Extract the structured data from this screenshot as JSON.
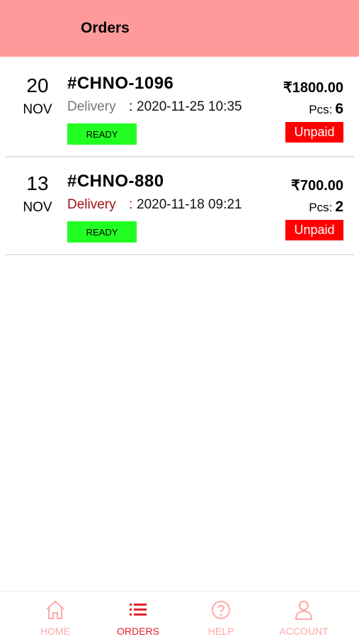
{
  "header": {
    "title": "Orders"
  },
  "orders": [
    {
      "day": "20",
      "month": "NOV",
      "order_no": "#CHNO-1096",
      "delivery_label": "Delivery",
      "colon": ":",
      "delivery_date": "2020-11-25 10:35",
      "status": "READY",
      "price": "₹1800.00",
      "pcs_label": "Pcs:",
      "pcs_value": "6",
      "payment": "Unpaid"
    },
    {
      "day": "13",
      "month": "NOV",
      "order_no": "#CHNO-880",
      "delivery_label": "Delivery",
      "colon": ":",
      "delivery_date": "2020-11-18 09:21",
      "status": "READY",
      "price": "₹700.00",
      "pcs_label": "Pcs:",
      "pcs_value": "2",
      "payment": "Unpaid"
    }
  ],
  "tabbar": {
    "home": {
      "label": "HOME",
      "icon": "home-icon"
    },
    "orders": {
      "label": "ORDERS",
      "icon": "list-icon"
    },
    "help": {
      "label": "HELP",
      "icon": "help-icon"
    },
    "account": {
      "label": "ACCOUNT",
      "icon": "user-icon"
    }
  },
  "colors": {
    "header_bg": "#ff9a9a",
    "ready": "#22ff22",
    "unpaid": "#ff0000",
    "tab_active": "#e8202a",
    "tab_inactive": "#ffa6a6",
    "delivery_highlight": "#a01010"
  }
}
